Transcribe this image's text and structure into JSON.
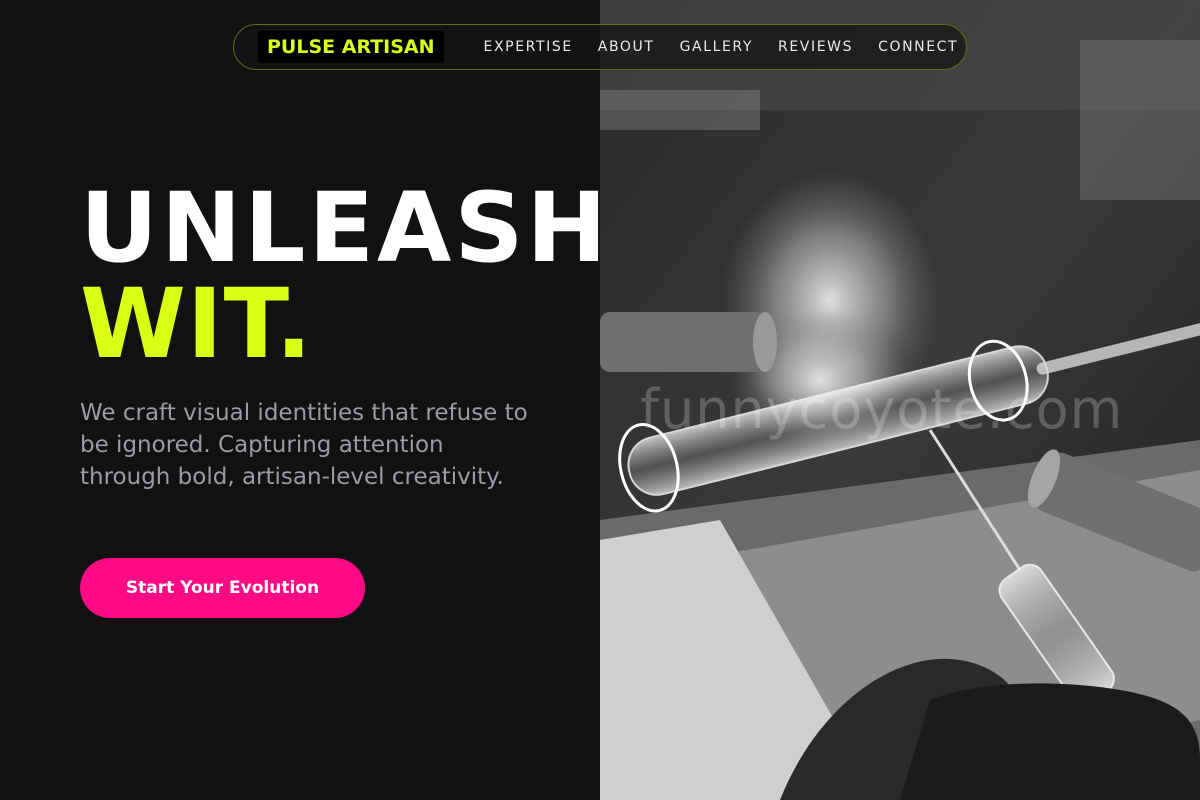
{
  "brand": {
    "name": "PULSE ARTISAN"
  },
  "nav": {
    "links": [
      {
        "label": "EXPERTISE"
      },
      {
        "label": "ABOUT"
      },
      {
        "label": "GALLERY"
      },
      {
        "label": "REVIEWS"
      },
      {
        "label": "CONNECT"
      }
    ]
  },
  "hero": {
    "title_line1": "UNLEASH",
    "title_line2": "WIT.",
    "description": "We craft visual identities that refuse to be ignored. Capturing attention through bold, artisan-level creativity.",
    "cta_label": "Start Your Evolution"
  },
  "image": {
    "watermark": "funnycoyote.com"
  },
  "colors": {
    "accent": "#dbff12",
    "cta": "#ff0a85",
    "background": "#111112"
  }
}
